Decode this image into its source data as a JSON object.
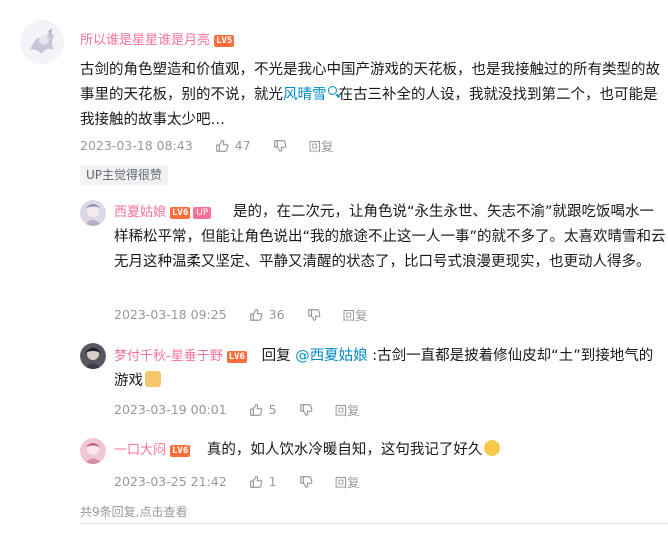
{
  "root": {
    "username": "所以谁是星星谁是月亮",
    "level": "LV5",
    "text_before": "古剑的角色塑造和价值观，不光是我心中国产游戏的天花板，也是我接触过的所有类型的故事里的天花板，别的不说，就光",
    "link_text": "风晴雪",
    "text_after": "在古三补全的人设，我就没找到第二个，也可能是我接触的故事太少吧…",
    "time": "2023-03-18 08:43",
    "likes": "47",
    "reply_label": "回复",
    "up_liked": "UP主觉得很赞"
  },
  "replies": [
    {
      "username": "西夏姑娘",
      "level": "LV6",
      "up_badge": "UP",
      "text": "是的，在二次元，让角色说“永生永世、矢志不渝”就跟吃饭喝水一样稀松平常，但能让角色说出“我的旅途不止这一人一事”的就不多了。太喜欢晴雪和云无月这种温柔又坚定、平静又清醒的状态了，比口号式浪漫更现实，也更动人得多。",
      "time": "2023-03-18 09:25",
      "likes": "36",
      "reply_label": "回复"
    },
    {
      "username": "梦付千秋-星垂于野",
      "level": "LV6",
      "reply_prefix": "回复",
      "at": "@西夏姑娘",
      "text": ":古剑一直都是披着修仙皮却“土”到接地气的游戏",
      "time": "2023-03-19 00:01",
      "likes": "5",
      "reply_label": "回复"
    },
    {
      "username": "一口大闷",
      "level": "LV6",
      "text": "真的，如人饮水冷暖自知，这句我记了好久",
      "time": "2023-03-25 21:42",
      "likes": "1",
      "reply_label": "回复"
    }
  ],
  "footer": {
    "count_text": "共9条回复,",
    "more_text": "点击查看"
  },
  "colors": {
    "username": "#fb7299",
    "link": "#008ac5",
    "meta": "#9499a0"
  }
}
